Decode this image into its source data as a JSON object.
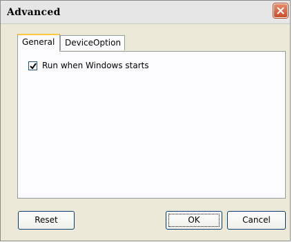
{
  "window": {
    "title": "Advanced"
  },
  "tabs": [
    {
      "label": "General",
      "selected": true
    },
    {
      "label": "DeviceOption",
      "selected": false
    }
  ],
  "general": {
    "run_on_startup": {
      "label": "Run when Windows starts",
      "checked": true
    }
  },
  "buttons": {
    "reset": "Reset",
    "ok": "OK",
    "cancel": "Cancel"
  },
  "icons": {
    "close": "close-icon",
    "check": "checkmark-icon"
  },
  "colors": {
    "close_button": "#d8603c",
    "tab_highlight": "#ffc83c",
    "dialog_bg": "#ece9d8"
  }
}
